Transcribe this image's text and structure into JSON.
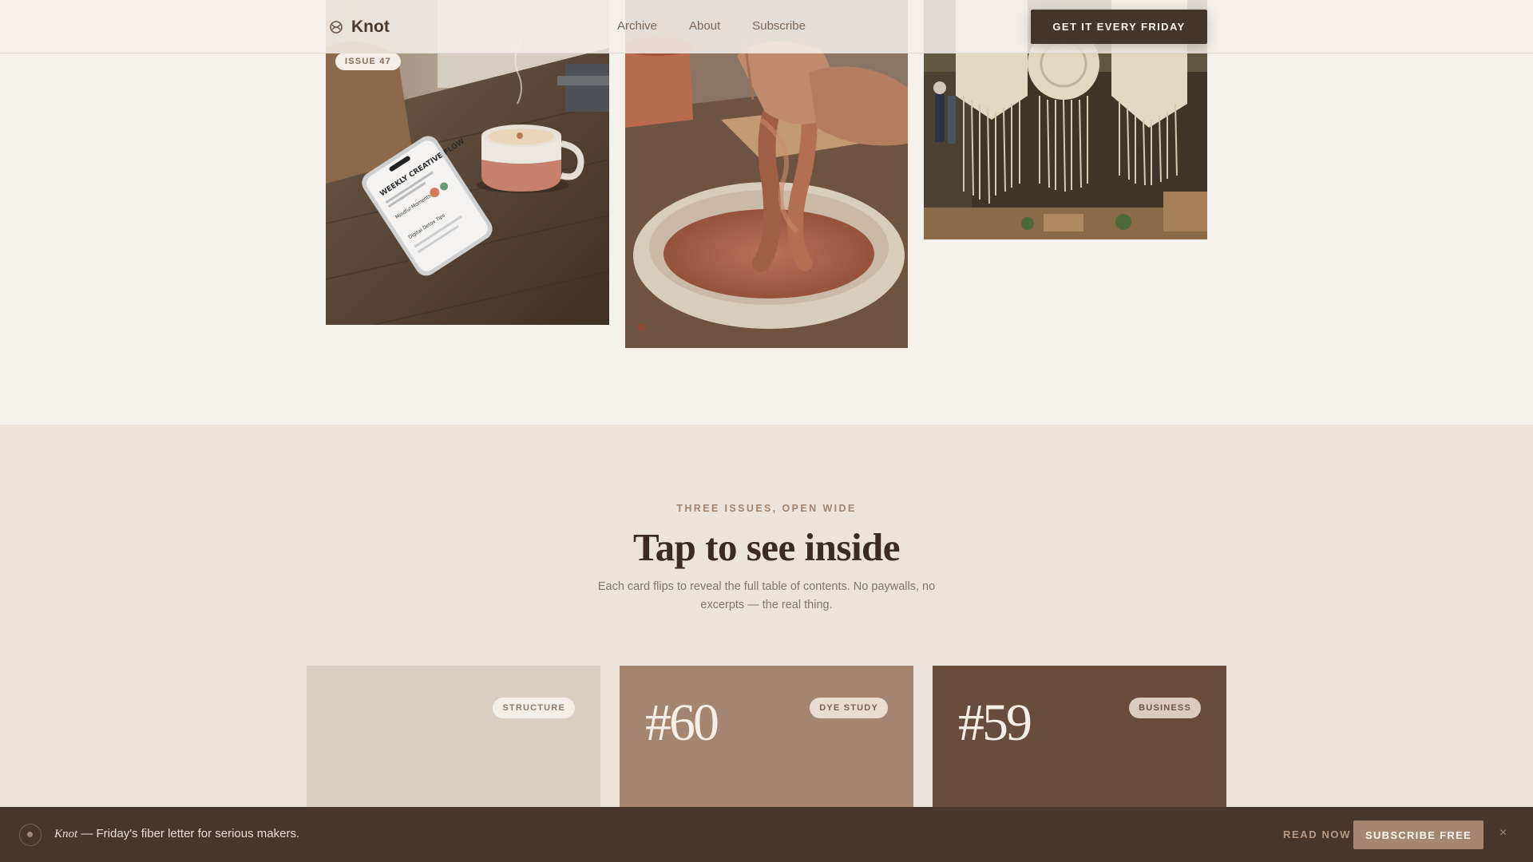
{
  "nav": {
    "brand": "Knot",
    "links": [
      "Archive",
      "About",
      "Subscribe"
    ],
    "cta": "GET IT EVERY FRIDAY"
  },
  "gallery": {
    "issue_badge": "ISSUE 47",
    "phone_screen": {
      "title": "WEEKLY CREATIVE FLOW",
      "lines": [
        "Mindful Moments",
        "Digital Detox Tips"
      ]
    }
  },
  "section": {
    "eyebrow": "THREE ISSUES, OPEN WIDE",
    "heading": "Tap to see inside",
    "subtext": "Each card flips to reveal the full table of contents. No paywalls, no excerpts — the real thing."
  },
  "cards": [
    {
      "number": "",
      "tag": "STRUCTURE",
      "color": "#d8cfc2"
    },
    {
      "number": "#60",
      "tag": "DYE STUDY",
      "color": "#a48571"
    },
    {
      "number": "#59",
      "tag": "BUSINESS",
      "color": "#684d3f"
    }
  ],
  "bottom_bar": {
    "brand": "Knot",
    "text": " — Friday's fiber letter for serious makers.",
    "read_now": "READ NOW",
    "subscribe": "SUBSCRIBE FREE",
    "close": "×"
  },
  "colors": {
    "page_bg": "#f4f0eb",
    "section_bg": "#ece4db",
    "dark_brown": "#45362c",
    "accent": "#a68670"
  }
}
